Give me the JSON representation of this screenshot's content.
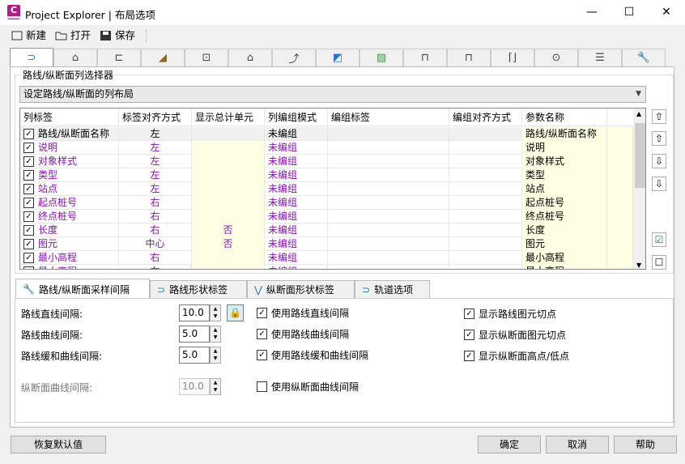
{
  "window": {
    "title": "Project Explorer | 布局选项",
    "app_icon_letter": "C",
    "min": "—",
    "max": "☐",
    "close": "✕"
  },
  "toolbar": {
    "new": "新建",
    "open": "打开",
    "save": "保存"
  },
  "top_tabs": [
    {
      "icon": "alignment-icon"
    },
    {
      "icon": "structure-icon"
    },
    {
      "icon": "profile-icon"
    },
    {
      "icon": "road-icon"
    },
    {
      "icon": "sample-icon"
    },
    {
      "icon": "surface-icon"
    },
    {
      "icon": "curve-icon"
    },
    {
      "icon": "pipe-icon"
    },
    {
      "icon": "map-icon"
    },
    {
      "icon": "bridge-icon"
    },
    {
      "icon": "bridge2-icon"
    },
    {
      "icon": "bracket-icon"
    },
    {
      "icon": "point-icon"
    },
    {
      "icon": "list-icon"
    },
    {
      "icon": "wrench-icon"
    }
  ],
  "selector": {
    "group_label": "路线/纵断面列选择器",
    "combo_value": "设定路线/纵断面的列布局"
  },
  "grid": {
    "headers": [
      "列标签",
      "标签对齐方式",
      "显示总计单元",
      "列编组模式",
      "编组标签",
      "编组对齐方式",
      "参数名称"
    ],
    "rows": [
      {
        "label": "路线/纵断面名称",
        "align": "左",
        "total": "",
        "mode": "未编组",
        "param": "路线/纵断面名称",
        "style": "selected"
      },
      {
        "label": "说明",
        "align": "左",
        "total": "",
        "mode": "未编组",
        "param": "说明",
        "style": "purple"
      },
      {
        "label": "对象样式",
        "align": "左",
        "total": "",
        "mode": "未编组",
        "param": "对象样式",
        "style": "purple"
      },
      {
        "label": "类型",
        "align": "左",
        "total": "",
        "mode": "未编组",
        "param": "类型",
        "style": "purple"
      },
      {
        "label": "站点",
        "align": "左",
        "total": "",
        "mode": "未编组",
        "param": "站点",
        "style": "purple"
      },
      {
        "label": "起点桩号",
        "align": "右",
        "total": "",
        "mode": "未编组",
        "param": "起点桩号",
        "style": "purple"
      },
      {
        "label": "终点桩号",
        "align": "右",
        "total": "",
        "mode": "未编组",
        "param": "终点桩号",
        "style": "purple"
      },
      {
        "label": "长度",
        "align": "右",
        "total": "否",
        "mode": "未编组",
        "param": "长度",
        "style": "purple"
      },
      {
        "label": "图元",
        "align": "中心",
        "total": "否",
        "mode": "未编组",
        "param": "图元",
        "style": "purple"
      },
      {
        "label": "最小高程",
        "align": "右",
        "total": "",
        "mode": "未编组",
        "param": "最小高程",
        "style": "purple"
      },
      {
        "label": "最大高程",
        "align": "右",
        "total": "",
        "mode": "未编组",
        "param": "最大高程",
        "style": "purple"
      }
    ]
  },
  "side_buttons": {
    "top": "⇧",
    "up": "⇧",
    "down": "⇩",
    "bottom": "⇩",
    "check_all": "☑",
    "uncheck_all": "☐"
  },
  "bottom_tabs": [
    "路线/纵断面采样间隔",
    "路线形状标签",
    "纵断面形状标签",
    "轨道选项"
  ],
  "intervals": [
    {
      "label": "路线直线间隔:",
      "value": "10.0",
      "checkbox": "使用路线直线间隔",
      "checked": true,
      "enabled": true
    },
    {
      "label": "路线曲线间隔:",
      "value": "5.0",
      "checkbox": "使用路线曲线间隔",
      "checked": true,
      "enabled": true
    },
    {
      "label": "路线缓和曲线间隔:",
      "value": "5.0",
      "checkbox": "使用路线缓和曲线间隔",
      "checked": true,
      "enabled": true
    },
    {
      "label": "纵断面曲线间隔:",
      "value": "10.0",
      "checkbox": "使用纵断面曲线间隔",
      "checked": false,
      "enabled": false
    }
  ],
  "display_options": [
    {
      "label": "显示路线图元切点",
      "checked": true
    },
    {
      "label": "显示纵断面图元切点",
      "checked": true
    },
    {
      "label": "显示纵断面高点/低点",
      "checked": true
    }
  ],
  "footer": {
    "restore": "恢复默认值",
    "ok": "确定",
    "cancel": "取消",
    "help": "帮助"
  },
  "colors": {
    "accent": "#8b12b8",
    "brand": "#b21d8a",
    "highlight": "#fefee2"
  }
}
